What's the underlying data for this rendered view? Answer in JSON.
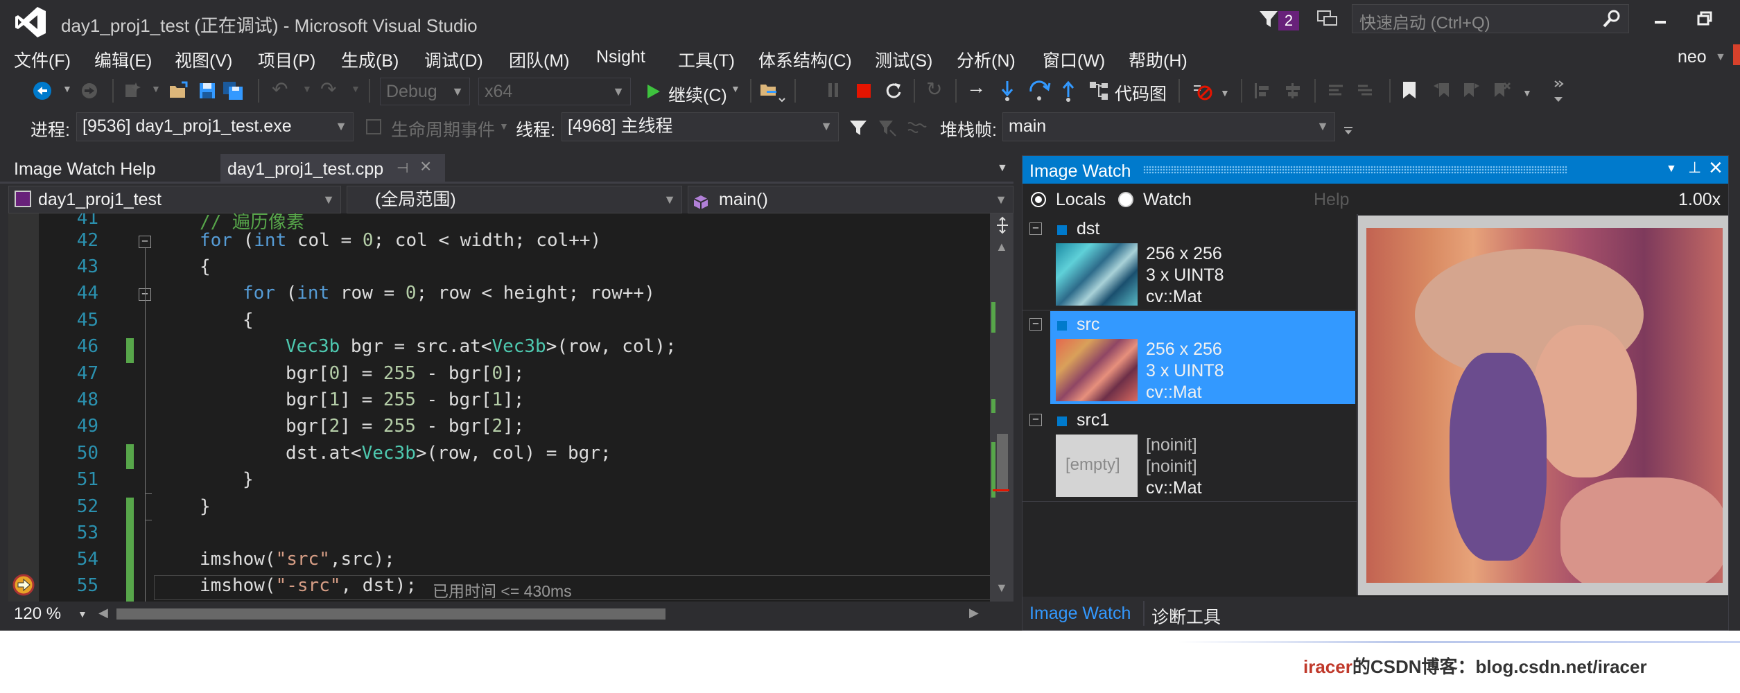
{
  "window": {
    "title": "day1_proj1_test (正在调试) - Microsoft Visual Studio",
    "notification_count": "2",
    "quick_launch_placeholder": "快速启动 (Ctrl+Q)",
    "user": "neo"
  },
  "menu": [
    "文件(F)",
    "编辑(E)",
    "视图(V)",
    "项目(P)",
    "生成(B)",
    "调试(D)",
    "团队(M)",
    "Nsight",
    "工具(T)",
    "体系结构(C)",
    "测试(S)",
    "分析(N)",
    "窗口(W)",
    "帮助(H)"
  ],
  "toolbar": {
    "config": "Debug",
    "platform": "x64",
    "continue_label": "继续(C)",
    "codemap_label": "代码图"
  },
  "debug_location": {
    "process_label": "进程:",
    "process_value": "[9536] day1_proj1_test.exe",
    "lifecycle_label": "生命周期事件",
    "thread_label": "线程:",
    "thread_value": "[4968] 主线程",
    "stackframe_label": "堆栈帧:",
    "stackframe_value": "main"
  },
  "tabs": {
    "help_tab": "Image Watch Help",
    "file_tab": "day1_proj1_test.cpp"
  },
  "navbar": {
    "project": "day1_proj1_test",
    "scope": "(全局范围)",
    "member": "main()"
  },
  "code": {
    "line_numbers": [
      "41",
      "42",
      "43",
      "44",
      "45",
      "46",
      "47",
      "48",
      "49",
      "50",
      "51",
      "52",
      "53",
      "54",
      "55"
    ],
    "line41_comment": "// 遍历像素",
    "elapsed_hint": "已用时间 <= 430ms"
  },
  "editor_status": {
    "zoom": "120 %"
  },
  "image_watch": {
    "title": "Image Watch",
    "locals_label": "Locals",
    "watch_label": "Watch",
    "help_label": "Help",
    "zoom": "1.00x",
    "items": [
      {
        "name": "dst",
        "line1": "256 x 256",
        "line2": "3 x UINT8",
        "line3": "cv::Mat",
        "selected": false
      },
      {
        "name": "src",
        "line1": "256 x 256",
        "line2": "3 x UINT8",
        "line3": "cv::Mat",
        "selected": true
      },
      {
        "name": "src1",
        "line1": "[noinit]",
        "line2": "[noinit]",
        "line3": "cv::Mat",
        "selected": false,
        "thumb_text": "[empty]"
      }
    ],
    "bottom_tabs": [
      "Image Watch",
      "诊断工具"
    ]
  },
  "watermark": {
    "brand": "iracer",
    "text": "的CSDN博客：blog.csdn.net/iracer"
  },
  "colors": {
    "accent": "#007acc",
    "selection": "#3399ff",
    "vs_logo": "#ffffff",
    "badge": "#68217a",
    "stop_red": "#e51400",
    "run_green": "#3ec23e"
  }
}
